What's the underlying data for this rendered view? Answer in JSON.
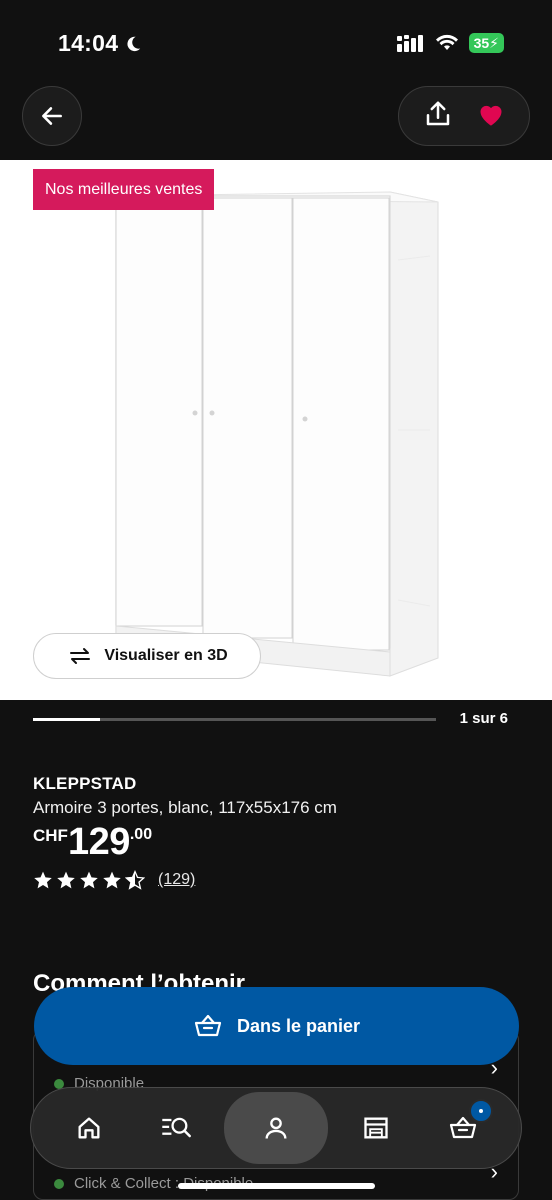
{
  "status": {
    "time": "14:04",
    "battery": "35"
  },
  "badge": "Nos meilleures ventes",
  "view3d_label": "Visualiser en 3D",
  "carousel": {
    "counter": "1 sur 6",
    "progress": 0.1667
  },
  "product": {
    "name": "KLEPPSTAD",
    "description": "Armoire 3 portes, blanc, 117x55x176 cm",
    "currency": "CHF",
    "price_main": "129",
    "price_decimals": ".00",
    "rating": 4.5,
    "reviews": "(129)"
  },
  "section_title": "Comment l’obtenir",
  "availability": [
    {
      "label": "Disponible"
    },
    {
      "label": "Click & Collect : Disponible"
    }
  ],
  "cart_button": "Dans le panier",
  "nav": [
    "home-icon",
    "search-icon",
    "account-icon",
    "store-icon",
    "cart-icon"
  ],
  "colors": {
    "accent": "#0058a3",
    "badge": "#d51a5c",
    "heart": "#e00751",
    "available": "#3b8a3e"
  }
}
